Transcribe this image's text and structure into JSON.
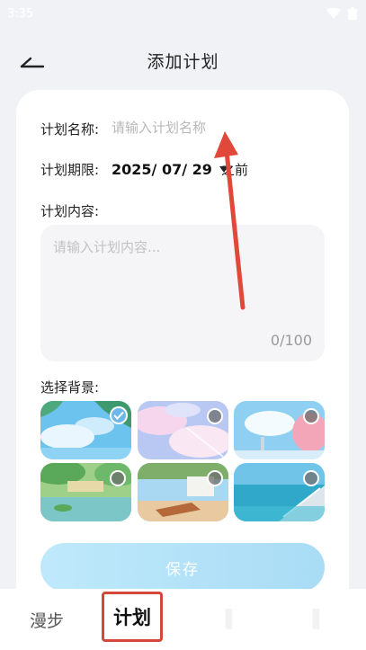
{
  "status_bar": {
    "time": "3:35"
  },
  "header": {
    "title": "添加计划"
  },
  "form": {
    "name_label": "计划名称:",
    "name_placeholder": "请输入计划名称",
    "deadline_label": "计划期限:",
    "deadline_value": "2025/ 07/ 29",
    "deadline_suffix": "之前",
    "content_label": "计划内容:",
    "content_placeholder": "请输入计划内容...",
    "content_counter": "0/100",
    "background_label": "选择背景:",
    "backgrounds": [
      {
        "name": "sky-trees",
        "selected": true
      },
      {
        "name": "pink-clouds",
        "selected": false
      },
      {
        "name": "sakura-sky",
        "selected": false
      },
      {
        "name": "garden-pond",
        "selected": false
      },
      {
        "name": "balcony-chair",
        "selected": false
      },
      {
        "name": "seaside-stairs",
        "selected": false
      }
    ],
    "save_label": "保存"
  },
  "tabbar": {
    "tabs": [
      {
        "label": "漫步"
      },
      {
        "label": "计划",
        "active": true
      }
    ]
  },
  "colors": {
    "accent": "#6fb6ea",
    "highlight_border": "#d4473a",
    "annotation_arrow": "#e0483a"
  }
}
